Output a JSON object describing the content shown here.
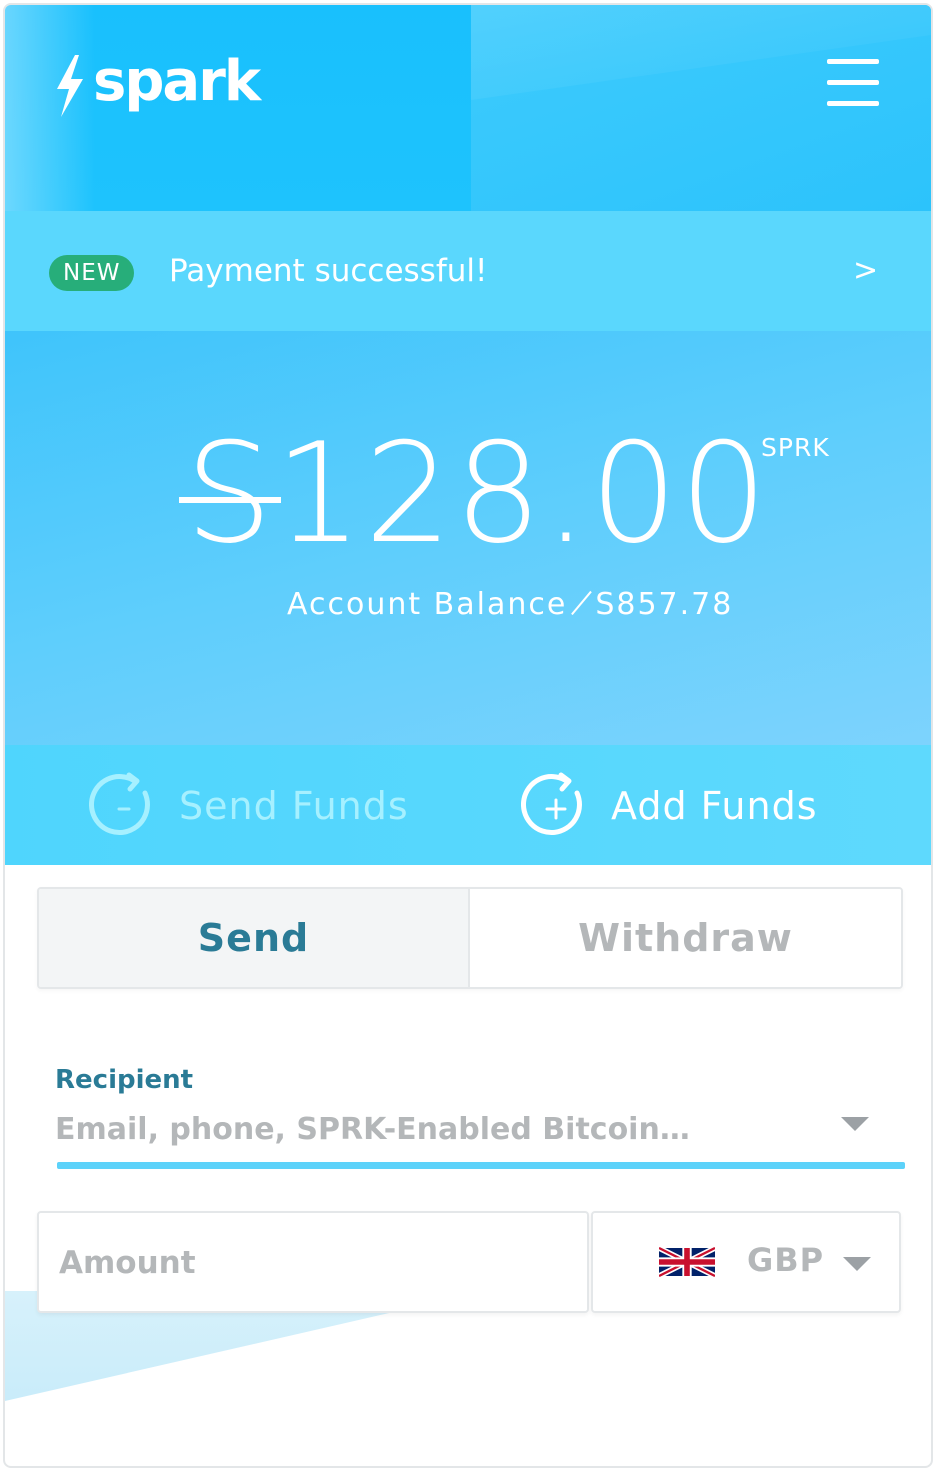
{
  "brand": {
    "name": "spark",
    "bolt_icon": "lightning-bolt-icon"
  },
  "header": {
    "menu_icon": "hamburger-menu-icon"
  },
  "notice": {
    "badge": "NEW",
    "message": "Payment successful!",
    "chevron": ">"
  },
  "balance": {
    "currency_symbol": "S",
    "amount": "128.00",
    "unit": "SPRK",
    "account_label": "Account Balance",
    "account_value": "̸S857.78"
  },
  "actions": {
    "send_label": "Send Funds",
    "send_icon": "circular-minus-icon",
    "add_label": "Add Funds",
    "add_icon": "circular-plus-icon"
  },
  "tabs": {
    "send_label": "Send",
    "withdraw_label": "Withdraw",
    "active": "Send"
  },
  "recipient": {
    "label": "Recipient",
    "placeholder": "Email, phone, SPRK-Enabled Bitcoin…"
  },
  "amount_field": {
    "placeholder": "Amount"
  },
  "currency": {
    "code": "GBP",
    "flag_icon": "uk-flag-icon"
  },
  "colors": {
    "header": "#19c0fd",
    "notice_bar": "#5ad7fd",
    "badge": "#27ae7a",
    "accent_text": "#2a7b96",
    "underline": "#5cd2fa"
  }
}
